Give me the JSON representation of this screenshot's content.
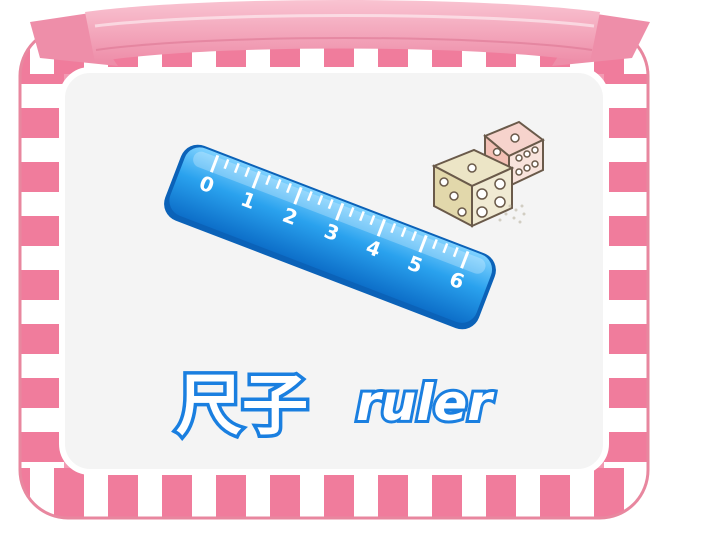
{
  "card": {
    "frame_color": "#f29bb3",
    "stripe_color": "#f07c9c",
    "inner_color": "#f4f4f4",
    "ribbon_color": "#f5a9bd"
  },
  "ruler": {
    "icon": "ruler-icon",
    "color": "#2a9be8",
    "ticks": [
      "0",
      "1",
      "2",
      "3",
      "4",
      "5",
      "6"
    ]
  },
  "dice": {
    "icon": "dice-icon"
  },
  "word": {
    "chinese": "尺子",
    "english": "ruler",
    "text_color": "#1a7fe0"
  }
}
